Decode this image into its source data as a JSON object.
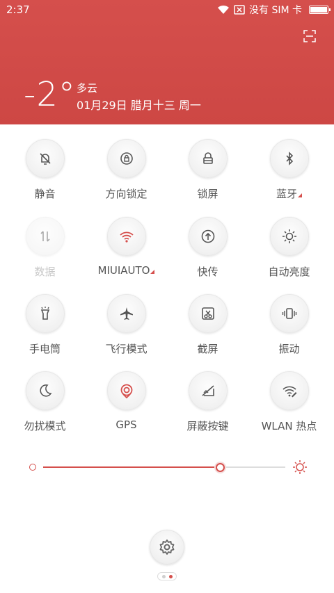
{
  "status_bar": {
    "time": "2:37",
    "carrier": "没有 SIM 卡",
    "icons": [
      "wifi-icon",
      "no-sim-icon",
      "battery-icon"
    ]
  },
  "weather": {
    "temperature": "-2°",
    "condition": "多云",
    "date": "01月29日 腊月十三 周一"
  },
  "toggles": [
    {
      "label": "静音",
      "icon": "bell-off-icon",
      "active": false,
      "disabled": false,
      "has_more": false
    },
    {
      "label": "方向锁定",
      "icon": "rotation-lock-icon",
      "active": false,
      "disabled": false,
      "has_more": false
    },
    {
      "label": "锁屏",
      "icon": "lock-icon",
      "active": false,
      "disabled": false,
      "has_more": false
    },
    {
      "label": "蓝牙",
      "icon": "bluetooth-icon",
      "active": false,
      "disabled": false,
      "has_more": true
    },
    {
      "label": "数据",
      "icon": "mobile-data-icon",
      "active": false,
      "disabled": true,
      "has_more": false
    },
    {
      "label": "MIUIAUTO",
      "icon": "wifi-icon",
      "active": true,
      "disabled": false,
      "has_more": true
    },
    {
      "label": "快传",
      "icon": "upload-icon",
      "active": false,
      "disabled": false,
      "has_more": false
    },
    {
      "label": "自动亮度",
      "icon": "auto-brightness-icon",
      "active": false,
      "disabled": false,
      "has_more": false
    },
    {
      "label": "手电筒",
      "icon": "flashlight-icon",
      "active": false,
      "disabled": false,
      "has_more": false
    },
    {
      "label": "飞行模式",
      "icon": "airplane-icon",
      "active": false,
      "disabled": false,
      "has_more": false
    },
    {
      "label": "截屏",
      "icon": "screenshot-icon",
      "active": false,
      "disabled": false,
      "has_more": false
    },
    {
      "label": "振动",
      "icon": "vibrate-icon",
      "active": false,
      "disabled": false,
      "has_more": false
    },
    {
      "label": "勿扰模式",
      "icon": "moon-icon",
      "active": false,
      "disabled": false,
      "has_more": false
    },
    {
      "label": "GPS",
      "icon": "gps-icon",
      "active": true,
      "disabled": false,
      "has_more": false
    },
    {
      "label": "屏蔽按键",
      "icon": "block-keys-icon",
      "active": false,
      "disabled": false,
      "has_more": false
    },
    {
      "label": "WLAN 热点",
      "icon": "hotspot-icon",
      "active": false,
      "disabled": false,
      "has_more": false
    }
  ],
  "brightness": {
    "value_fraction": 0.73
  },
  "colors": {
    "accent": "#d54f4c",
    "header_bg": "#d04a47",
    "label": "#555555",
    "icon": "#555555"
  },
  "pager": {
    "pages": 2,
    "current": 2
  }
}
